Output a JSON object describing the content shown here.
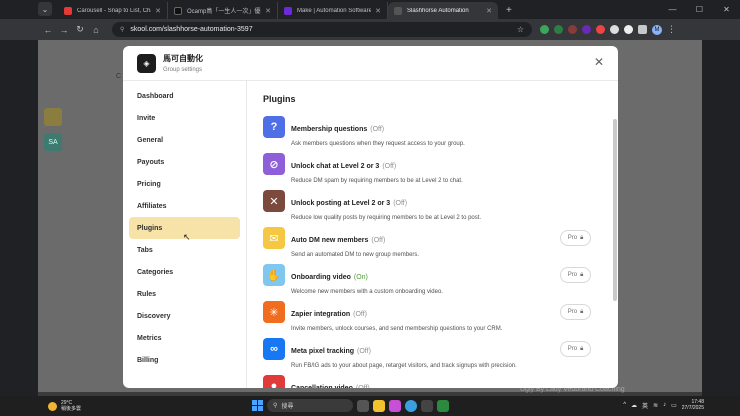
{
  "browser": {
    "tabs": [
      {
        "label": "Carousell - Snap to List, Chat",
        "color": "#e53935",
        "active": false
      },
      {
        "label": "Ocamp鳥「一生人一次」優惠",
        "color": "#202124",
        "active": false
      },
      {
        "label": "Make | Automation Software",
        "color": "#6d28d9",
        "active": false
      },
      {
        "label": "Slashhorse Automation",
        "color": "#3a3a3a",
        "active": true
      }
    ],
    "url": "skool.com/slashhorse-automation-3597"
  },
  "modal": {
    "group_name": "馬可自動化",
    "subtitle": "Group settings",
    "nav": [
      {
        "label": "Dashboard",
        "active": false
      },
      {
        "label": "Invite",
        "active": false
      },
      {
        "label": "General",
        "active": false
      },
      {
        "label": "Payouts",
        "active": false
      },
      {
        "label": "Pricing",
        "active": false
      },
      {
        "label": "Affiliates",
        "active": false
      },
      {
        "label": "Plugins",
        "active": true
      },
      {
        "label": "Tabs",
        "active": false
      },
      {
        "label": "Categories",
        "active": false
      },
      {
        "label": "Rules",
        "active": false
      },
      {
        "label": "Discovery",
        "active": false
      },
      {
        "label": "Metrics",
        "active": false
      },
      {
        "label": "Billing",
        "active": false
      }
    ],
    "content_title": "Plugins",
    "plugins": [
      {
        "name": "Membership questions",
        "status": "(Off)",
        "desc": "Ask members questions when they request access to your group.",
        "icon": "question-icon",
        "glyph": "?",
        "color": "#4f6fe6",
        "pro": ""
      },
      {
        "name": "Unlock chat at Level 2 or 3",
        "status": "(Off)",
        "desc": "Reduce DM spam by requiring members to be at Level 2 to chat.",
        "icon": "chat-lock-icon",
        "glyph": "⊘",
        "color": "#8e5fd8",
        "pro": ""
      },
      {
        "name": "Unlock posting at Level 2 or 3",
        "status": "(Off)",
        "desc": "Reduce low quality posts by requiring members to be at Level 2 to post.",
        "icon": "no-post-icon",
        "glyph": "✕",
        "color": "#7b4a3c",
        "pro": ""
      },
      {
        "name": "Auto DM new members",
        "status": "(Off)",
        "desc": "Send an automated DM to new group members.",
        "icon": "megaphone-icon",
        "glyph": "✉",
        "color": "#f4c842",
        "pro": "Pro"
      },
      {
        "name": "Onboarding video",
        "status": "(On)",
        "desc": "Welcome new members with a custom onboarding video.",
        "icon": "wave-hand-icon",
        "glyph": "✋",
        "color": "#7fc6f0",
        "pro": "Pro"
      },
      {
        "name": "Zapier integration",
        "status": "(Off)",
        "desc": "Invite members, unlock courses, and send membership questions to your CRM.",
        "icon": "zapier-icon",
        "glyph": "✳",
        "color": "#f06d1f",
        "pro": "Pro"
      },
      {
        "name": "Meta pixel tracking",
        "status": "(Off)",
        "desc": "Run FB/IG ads to your about page, retarget visitors, and track signups with precision.",
        "icon": "meta-icon",
        "glyph": "∞",
        "color": "#1877f2",
        "pro": "Pro"
      },
      {
        "name": "Cancellation video",
        "status": "(Off)",
        "desc": "",
        "icon": "video-icon",
        "glyph": "●",
        "color": "#e03a3a",
        "pro": ""
      }
    ]
  },
  "taskbar": {
    "temperature": "29°C",
    "weather_text": "稍後多雲",
    "search_placeholder": "搜尋",
    "ime": "英",
    "time": "17:48",
    "date": "27/7/2025"
  },
  "background": {
    "watermark": "Ugly By Lady Vedbrand Coaching",
    "bg_letter": "C",
    "bg_badge": "SA"
  }
}
